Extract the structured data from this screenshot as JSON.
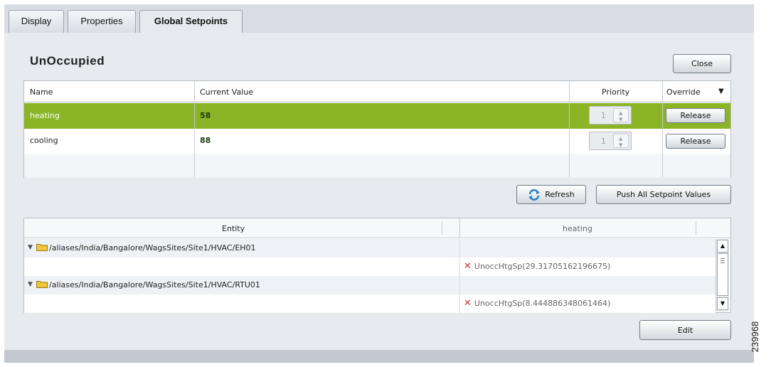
{
  "tabs": [
    {
      "label": "Display"
    },
    {
      "label": "Properties"
    },
    {
      "label": "Global Setpoints",
      "active": true
    }
  ],
  "section_title": "UnOccupied",
  "close_label": "Close",
  "setpoint_table": {
    "columns": [
      "Name",
      "Current Value",
      "Priority",
      "Override"
    ],
    "override_arrow": "▼",
    "rows": [
      {
        "name": "heating",
        "value": "58",
        "priority": "1",
        "override": "Release",
        "selected": true
      },
      {
        "name": "cooling",
        "value": "88",
        "priority": "1",
        "override": "Release"
      }
    ]
  },
  "refresh_label": "Refresh",
  "push_label": "Push All Setpoint Values",
  "entity_table": {
    "columns": [
      "Entity",
      "heating"
    ],
    "rows": [
      {
        "entity": "/aliases/India/Bangalore/WagsSites/Site1/HVAC/EH01",
        "value": ""
      },
      {
        "entity": "",
        "value": "UnoccHtgSp(29.31705162196675)"
      },
      {
        "entity": "/aliases/India/Bangalore/WagsSites/Site1/HVAC/RTU01",
        "value": ""
      },
      {
        "entity": "",
        "value": "UnoccHtgSp(8.444886348061464)"
      }
    ]
  },
  "edit_label": "Edit",
  "figure_id": "239968",
  "colors": {
    "selected_row": "#8bb526",
    "error_x": "#d0361f",
    "folder": "#f2c53d"
  }
}
